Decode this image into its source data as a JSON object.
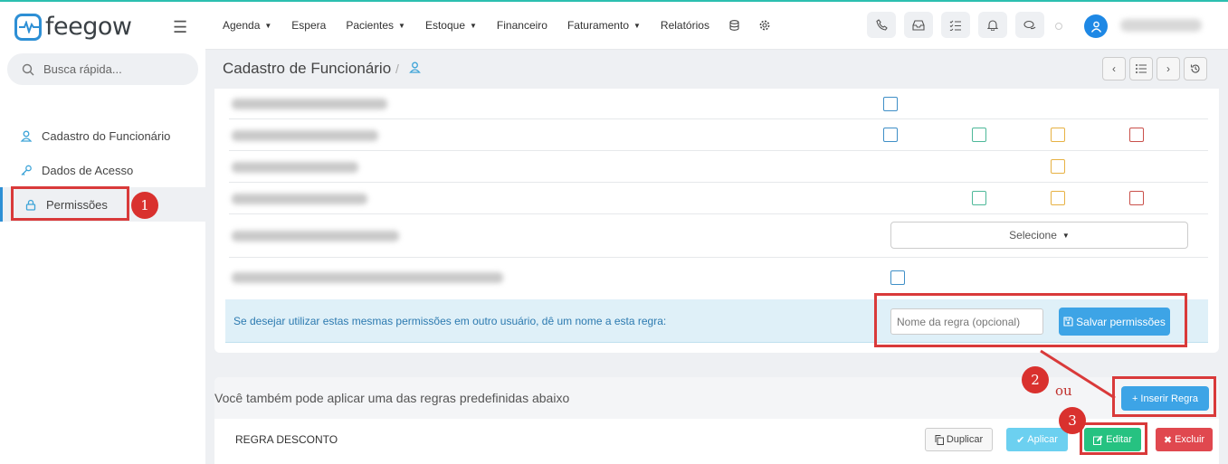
{
  "sidebar": {
    "logo_text": "feegow",
    "search_placeholder": "Busca rápida...",
    "items": [
      {
        "label": "Cadastro do Funcionário",
        "icon": "user-icon"
      },
      {
        "label": "Dados de Acesso",
        "icon": "key-icon"
      },
      {
        "label": "Permissões",
        "icon": "lock-icon"
      }
    ]
  },
  "topnav": {
    "items": [
      {
        "label": "Agenda",
        "dropdown": true
      },
      {
        "label": "Espera",
        "dropdown": false
      },
      {
        "label": "Pacientes",
        "dropdown": true
      },
      {
        "label": "Estoque",
        "dropdown": true
      },
      {
        "label": "Financeiro",
        "dropdown": false
      },
      {
        "label": "Faturamento",
        "dropdown": true
      },
      {
        "label": "Relatórios",
        "dropdown": false
      }
    ],
    "icons": [
      "phone-icon",
      "inbox-icon",
      "tasks-icon",
      "bell-icon",
      "chat-icon"
    ]
  },
  "header": {
    "title": "Cadastro de Funcionário",
    "separator": "/"
  },
  "permissions": {
    "select_label": "Selecione",
    "rule_prompt": "Se desejar utilizar estas mesmas permissões em outro usuário, dê um nome a esta regra:",
    "rule_input_placeholder": "Nome da regra (opcional)",
    "save_button": "Salvar permissões"
  },
  "predefined": {
    "title": "Você também pode aplicar uma das regras predefinidas abaixo",
    "insert_button": "Inserir Regra",
    "rules": [
      {
        "name": "REGRA DESCONTO"
      }
    ],
    "duplicate_button": "Duplicar",
    "apply_button": "Aplicar",
    "edit_button": "Editar",
    "delete_button": "Excluir"
  },
  "annotations": {
    "badge_1": "1",
    "badge_2": "2",
    "badge_3": "3",
    "or_text": "ou",
    "color": "#d93a3a"
  },
  "colors": {
    "accent": "#2d8fd5",
    "primary_button": "#3da4e6",
    "success": "#26c281",
    "danger": "#e0484f",
    "info": "#6cd0f0"
  }
}
